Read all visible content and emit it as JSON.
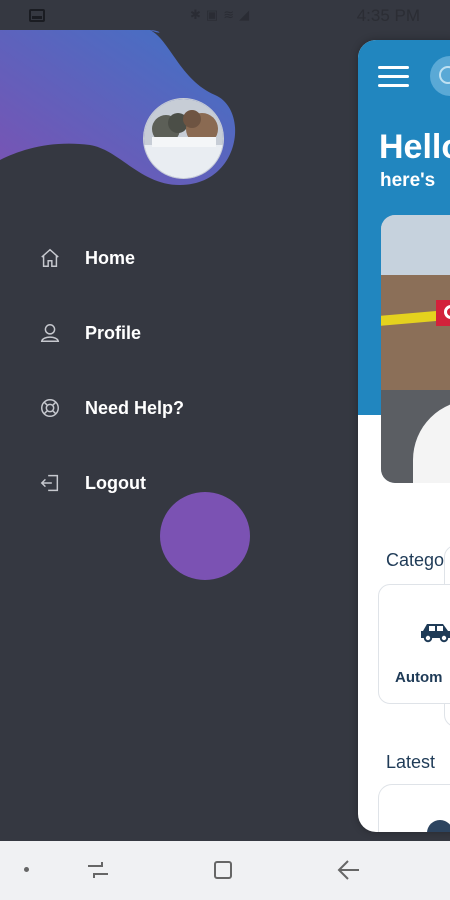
{
  "status_bar": {
    "time": "4:35 PM",
    "icons": [
      "notification-icon",
      "bluetooth-icon",
      "nfc-icon",
      "wifi-icon",
      "signal-icon"
    ]
  },
  "drawer": {
    "menu": [
      {
        "label": "Home",
        "icon": "home-icon"
      },
      {
        "label": "Profile",
        "icon": "user-icon"
      },
      {
        "label": "Need Help?",
        "icon": "lifebuoy-icon"
      },
      {
        "label": "Logout",
        "icon": "logout-icon"
      }
    ],
    "colors": {
      "background": "#353841",
      "blob_start": "#7b52b3",
      "blob_end": "#3f73c6",
      "circle": "#7b52b3"
    }
  },
  "main_preview": {
    "greeting": "Hello",
    "subtitle": "here's",
    "categories_title": "Catego",
    "category_label": "Autom",
    "latest_title": "Latest",
    "accent": "#2186bf"
  }
}
